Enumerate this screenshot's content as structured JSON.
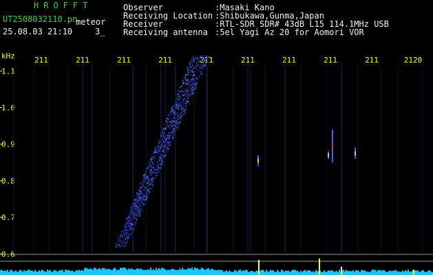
{
  "app": {
    "title": "HROFFT",
    "file_name": "UT2508032110.pn",
    "mode_label": "meteor",
    "datetime": "25.08.03 21:10",
    "counter": "3_"
  },
  "info": [
    {
      "label": "Observer",
      "value": ":Masaki Kano"
    },
    {
      "label": "Receiving Location",
      "value": ":Shibukawa,Gunma,Japan"
    },
    {
      "label": "Receiver",
      "value": ":RTL-SDR SDR# 43dB L15 114.1MHz USB"
    },
    {
      "label": "Receiving antenna",
      "value": ":5el Yagi Az 20 for Aomori VOR"
    }
  ],
  "colors": {
    "background": "#000000",
    "title_green": "#39d43a",
    "text_white": "#f2f2f2",
    "axis_yellow": "#ffff00",
    "trace_blue": "#3a5cff",
    "spectrum_cyan": "#19c6ff"
  },
  "chart_data": {
    "type": "heatmap",
    "x_axis": {
      "unit_label": "kHz",
      "tick_labels": [
        "211",
        "211",
        "211",
        "211",
        "211",
        "211",
        "211",
        "211",
        "211",
        "2120"
      ]
    },
    "y_axis": {
      "tick_labels": [
        "1.1",
        "1.0",
        "0.9",
        "0.8",
        "0.7",
        "0.6"
      ],
      "range": [
        0.58,
        1.14
      ]
    },
    "meteor_trace": {
      "description_points": [
        [
          0.9,
          1.14
        ],
        [
          0.1,
          0.62
        ]
      ]
    },
    "pings": [
      {
        "tick": 5.25,
        "y_top": 0.87,
        "y_bottom": 0.84
      },
      {
        "tick": 6.95,
        "y_top": 0.88,
        "y_bottom": 0.86
      },
      {
        "tick": 7.05,
        "y_top": 0.94,
        "y_bottom": 0.85
      },
      {
        "tick": 7.6,
        "y_top": 0.89,
        "y_bottom": 0.86
      }
    ]
  }
}
